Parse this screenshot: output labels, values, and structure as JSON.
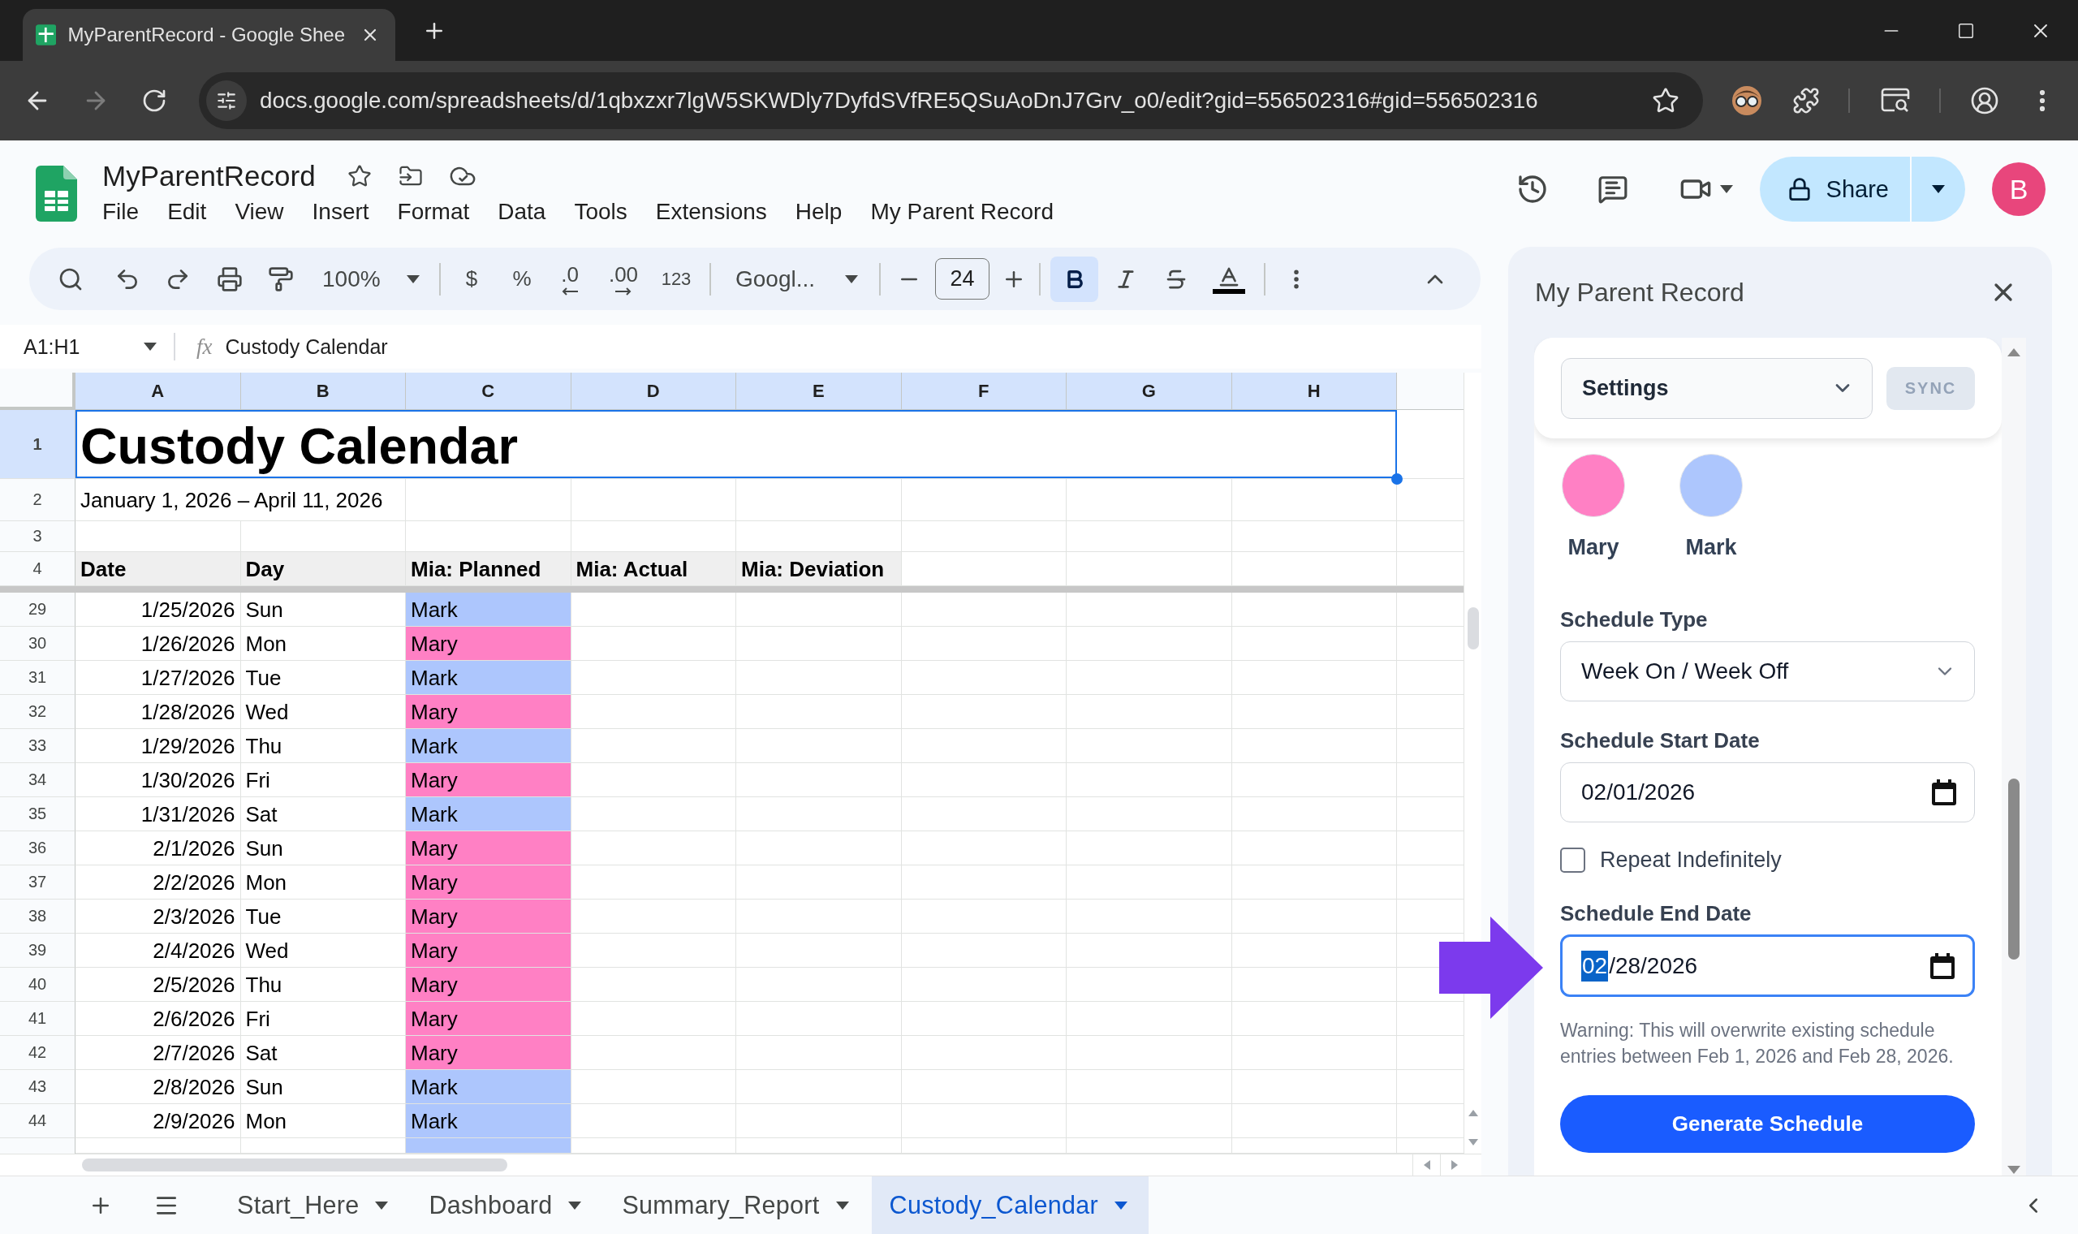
{
  "browser": {
    "tab_title": "MyParentRecord - Google Shee",
    "url": "docs.google.com/spreadsheets/d/1qbxzxr7lgW5SKWDly7DyfdSVfRE5QSuAoDnJ7Grv_o0/edit?gid=556502316#gid=556502316"
  },
  "app": {
    "title": "MyParentRecord",
    "menu": [
      "File",
      "Edit",
      "View",
      "Insert",
      "Format",
      "Data",
      "Tools",
      "Extensions",
      "Help",
      "My Parent Record"
    ],
    "share": "Share",
    "avatar": "B"
  },
  "toolbar": {
    "zoom": "100%",
    "currency": "$",
    "percent": "%",
    "decrease_decimal": ".0",
    "increase_decimal": ".00",
    "number_format": "123",
    "font": "Googl...",
    "font_size": "24",
    "bold": true,
    "italic": false,
    "strikethrough": false
  },
  "formula_bar": {
    "name_box": "A1:H1",
    "fx": "fx",
    "content": "Custody Calendar"
  },
  "sheet": {
    "columns": [
      {
        "label": "A",
        "selected": true
      },
      {
        "label": "B",
        "selected": true
      },
      {
        "label": "C",
        "selected": true
      },
      {
        "label": "D",
        "selected": true
      },
      {
        "label": "E",
        "selected": true
      },
      {
        "label": "F",
        "selected": true
      },
      {
        "label": "G",
        "selected": true
      },
      {
        "label": "H",
        "selected": true
      }
    ],
    "rows": [
      {
        "kind": "title",
        "number": "1",
        "selected": true,
        "cells": [
          "Custody Calendar"
        ]
      },
      {
        "kind": "subtitle",
        "number": "2",
        "selected": false,
        "cells": [
          "January 1, 2026 – April 11, 2026"
        ]
      },
      {
        "kind": "blank",
        "number": "3",
        "selected": false
      },
      {
        "kind": "header",
        "number": "4",
        "selected": false,
        "cells": [
          "Date",
          "Day",
          "Mia: Planned",
          "Mia: Actual",
          "Mia: Deviation"
        ]
      },
      {
        "kind": "data",
        "number": "29",
        "selected": false,
        "cells": [
          "1/25/2026",
          "Sun",
          "Mark"
        ],
        "color": "#adc6fd"
      },
      {
        "kind": "data",
        "number": "30",
        "selected": false,
        "cells": [
          "1/26/2026",
          "Mon",
          "Mary"
        ],
        "color": "#ff80c4"
      },
      {
        "kind": "data",
        "number": "31",
        "selected": false,
        "cells": [
          "1/27/2026",
          "Tue",
          "Mark"
        ],
        "color": "#adc6fd"
      },
      {
        "kind": "data",
        "number": "32",
        "selected": false,
        "cells": [
          "1/28/2026",
          "Wed",
          "Mary"
        ],
        "color": "#ff80c4"
      },
      {
        "kind": "data",
        "number": "33",
        "selected": false,
        "cells": [
          "1/29/2026",
          "Thu",
          "Mark"
        ],
        "color": "#adc6fd"
      },
      {
        "kind": "data",
        "number": "34",
        "selected": false,
        "cells": [
          "1/30/2026",
          "Fri",
          "Mary"
        ],
        "color": "#ff80c4"
      },
      {
        "kind": "data",
        "number": "35",
        "selected": false,
        "cells": [
          "1/31/2026",
          "Sat",
          "Mark"
        ],
        "color": "#adc6fd"
      },
      {
        "kind": "data",
        "number": "36",
        "selected": false,
        "cells": [
          "2/1/2026",
          "Sun",
          "Mary"
        ],
        "color": "#ff80c4"
      },
      {
        "kind": "data",
        "number": "37",
        "selected": false,
        "cells": [
          "2/2/2026",
          "Mon",
          "Mary"
        ],
        "color": "#ff80c4"
      },
      {
        "kind": "data",
        "number": "38",
        "selected": false,
        "cells": [
          "2/3/2026",
          "Tue",
          "Mary"
        ],
        "color": "#ff80c4"
      },
      {
        "kind": "data",
        "number": "39",
        "selected": false,
        "cells": [
          "2/4/2026",
          "Wed",
          "Mary"
        ],
        "color": "#ff80c4"
      },
      {
        "kind": "data",
        "number": "40",
        "selected": false,
        "cells": [
          "2/5/2026",
          "Thu",
          "Mary"
        ],
        "color": "#ff80c4"
      },
      {
        "kind": "data",
        "number": "41",
        "selected": false,
        "cells": [
          "2/6/2026",
          "Fri",
          "Mary"
        ],
        "color": "#ff80c4"
      },
      {
        "kind": "data",
        "number": "42",
        "selected": false,
        "cells": [
          "2/7/2026",
          "Sat",
          "Mary"
        ],
        "color": "#ff80c4"
      },
      {
        "kind": "data",
        "number": "43",
        "selected": false,
        "cells": [
          "2/8/2026",
          "Sun",
          "Mark"
        ],
        "color": "#adc6fd"
      },
      {
        "kind": "data",
        "number": "44",
        "selected": false,
        "cells": [
          "2/9/2026",
          "Mon",
          "Mark"
        ],
        "color": "#adc6fd"
      }
    ],
    "partial_row": {
      "color": "#adc6fd"
    }
  },
  "sheet_tabs": [
    {
      "label": "Start_Here",
      "selected": false
    },
    {
      "label": "Dashboard",
      "selected": false
    },
    {
      "label": "Summary_Report",
      "selected": false
    },
    {
      "label": "Custody_Calendar",
      "selected": true
    }
  ],
  "panel": {
    "title": "My Parent Record",
    "view": "Settings",
    "sync": "SYNC",
    "parents": [
      {
        "name": "Mary",
        "color": "#ff80c4"
      },
      {
        "name": "Mark",
        "color": "#adc6fd"
      }
    ],
    "schedule_type": {
      "label": "Schedule Type",
      "value": "Week On / Week Off"
    },
    "start_date": {
      "label": "Schedule Start Date",
      "value": "02/01/2026"
    },
    "repeat": {
      "label": "Repeat Indefinitely",
      "checked": false
    },
    "end_date": {
      "label": "Schedule End Date",
      "focused": true,
      "segments": [
        {
          "text": "02",
          "selected": true
        },
        {
          "text": "/28/2026",
          "selected": false
        }
      ]
    },
    "warning": "Warning: This will overwrite existing schedule entries between Feb 1, 2026 and Feb 28, 2026.",
    "button": "Generate Schedule"
  }
}
